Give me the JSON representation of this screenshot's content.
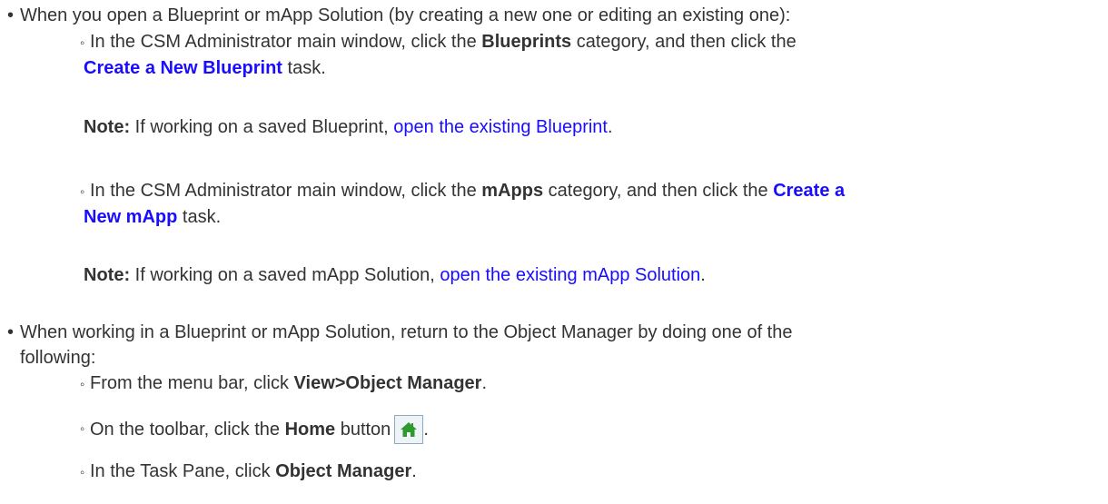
{
  "bullet_main": "•",
  "bullet_sub": "◦",
  "item1": {
    "text": "When you open a Blueprint or mApp Solution (by creating a new one or editing an existing one):",
    "sub1": {
      "t1": "In the CSM Administrator main window, click the ",
      "b1": "Blueprints",
      "t2": " category, and then click the",
      "link1": "Create a New Blueprint",
      "t3": " task.",
      "note_label": "Note:",
      "note_text": " If working on a saved Blueprint, ",
      "note_link": "open the existing Blueprint",
      "note_end": "."
    },
    "sub2": {
      "t1": "In the CSM Administrator main window, click the ",
      "b1": "mApps",
      "t2": " category, and then click the ",
      "link1a": "Create a",
      "link1b": "New mApp",
      "t3": " task.",
      "note_label": "Note:",
      "note_text": " If working on a saved mApp Solution, ",
      "note_link": "open the existing mApp Solution",
      "note_end": "."
    }
  },
  "item2": {
    "text_line1": "When working in a Blueprint or mApp Solution, return to the Object Manager by doing one of the",
    "text_line2": "following:",
    "sub1": {
      "t1": "From the menu bar, click ",
      "b1": "View>Object Manager",
      "t2": "."
    },
    "sub2": {
      "t1": "On the toolbar, click the ",
      "b1": "Home",
      "t2": " button",
      "t3": "."
    },
    "sub3": {
      "t1": "In the Task Pane, click ",
      "b1": "Object Manager",
      "t2": "."
    }
  },
  "colors": {
    "link": "#1a0dff",
    "text": "#333333",
    "home_icon": "#2e9a2e"
  },
  "icons": {
    "home": "home-icon"
  }
}
